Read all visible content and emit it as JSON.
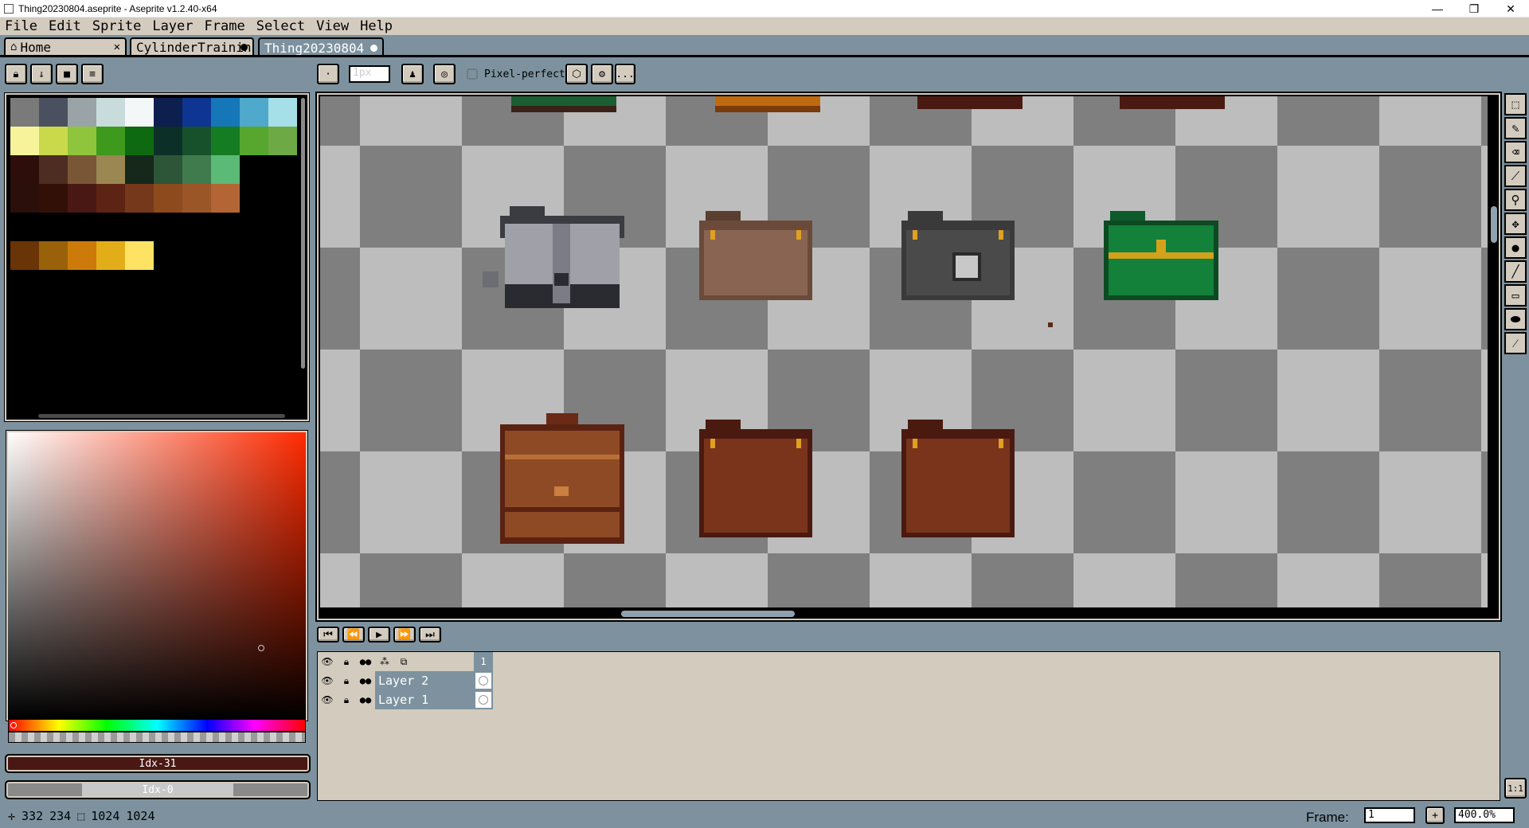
{
  "window": {
    "title": "Thing20230804.aseprite - Aseprite v1.2.40-x64",
    "controls": [
      "—",
      "❐",
      "✕"
    ]
  },
  "menu": [
    "File",
    "Edit",
    "Sprite",
    "Layer",
    "Frame",
    "Select",
    "View",
    "Help"
  ],
  "tabs": [
    {
      "label": "Home",
      "icon": "home-icon",
      "closable": true
    },
    {
      "label": "CylinderTrainin",
      "modified": true
    },
    {
      "label": "Thing20230804",
      "modified": true,
      "active": true
    }
  ],
  "left_toolbar": {
    "icons": [
      "lock-icon",
      "arrow-down-icon",
      "square-icon",
      "menu-icon"
    ]
  },
  "context_bar": {
    "brush_size": "1px",
    "pixel_perfect_label": "Pixel-perfect",
    "more_label": "..."
  },
  "palette": {
    "rows": [
      [
        "#7a7a7a",
        "#4a5060",
        "#9aa3a6",
        "#c9dcdc",
        "#f4f7f7",
        "#0d1f4f",
        "#0e3592",
        "#1577b7",
        "#4fa9cc",
        "#a7dfe8"
      ],
      [
        "#f7f39b",
        "#c9d94a",
        "#8ec53c",
        "#3e9a1d",
        "#0d6a10",
        "#0c3028",
        "#16512c",
        "#157c22",
        "#57a72f",
        "#6da944"
      ],
      [
        "#2d0e0a",
        "#4d2c21",
        "#795736",
        "#9a8752",
        "#15281a",
        "#2d5537",
        "#3f7b4c",
        "#5bba76"
      ],
      [
        "#2a0f0b",
        "#321008",
        "#4a1814",
        "#5e2413",
        "#76381b",
        "#8c4a1d",
        "#9b5627",
        "#b46535"
      ],
      [],
      [
        "#6a3406",
        "#99610a",
        "#cc7b0a",
        "#e3ad1a",
        "#fde264"
      ]
    ]
  },
  "color": {
    "fg_label": "Idx-31",
    "bg_label": "Idx-0",
    "fg_hex": "#4a1814"
  },
  "status": {
    "pos_x": "332",
    "pos_y": "234",
    "size_w": "1024",
    "size_h": "1024",
    "frame_label": "Frame:",
    "frame_value": "1",
    "zoom_value": "400.0%"
  },
  "timeline": {
    "frame_number": "1",
    "layers": [
      {
        "name": "Layer 2",
        "selected": true
      },
      {
        "name": "Layer 1",
        "selected": false
      }
    ]
  },
  "tools": [
    "marquee-icon",
    "pencil-icon",
    "eraser-icon",
    "eyedropper-icon",
    "zoom-icon",
    "move-icon",
    "bucket-icon",
    "line-icon",
    "rectangle-icon",
    "blob-icon",
    "brush-icon"
  ],
  "bottom_right_label": "1:1"
}
